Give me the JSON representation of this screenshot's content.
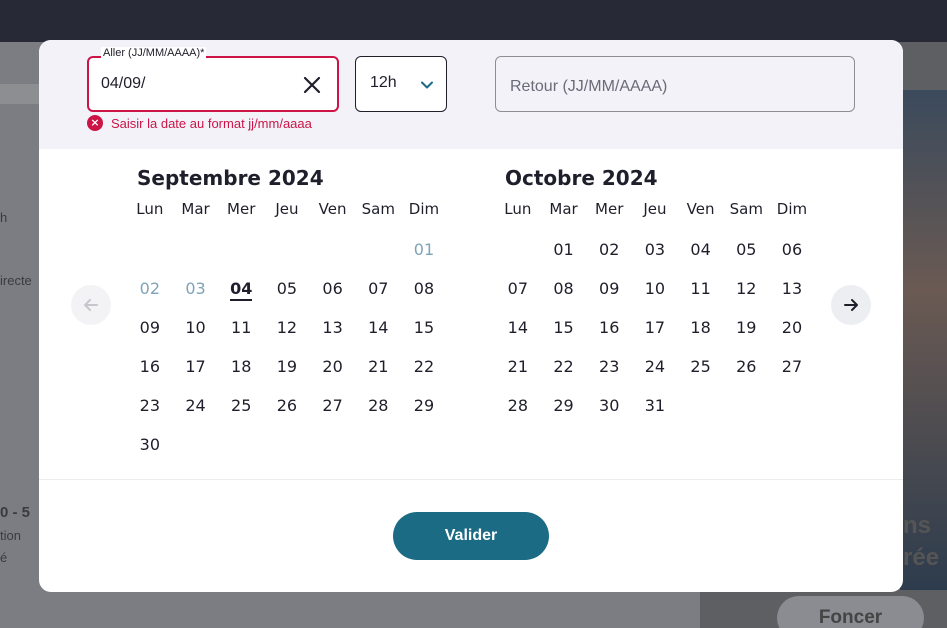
{
  "background": {
    "bg_text_1": "h",
    "bg_text_2": "irecte",
    "bg_text_3": "0 - 5",
    "bg_text_4": "tion",
    "bg_text_5": "é",
    "bg_text_6": "ns",
    "bg_text_7": "rée",
    "bg_button": "Foncer"
  },
  "form": {
    "aller": {
      "label": "Aller (JJ/MM/AAAA)*",
      "value": "04/09/",
      "error": "Saisir la date au format jj/mm/aaaa",
      "clear_icon": "close-icon"
    },
    "time": {
      "value": "12h",
      "icon": "chevron-down-icon"
    },
    "retour": {
      "placeholder": "Retour (JJ/MM/AAAA)"
    }
  },
  "weekdays": [
    "Lun",
    "Mar",
    "Mer",
    "Jeu",
    "Ven",
    "Sam",
    "Dim"
  ],
  "calendars": [
    {
      "title": "Septembre 2024",
      "offset": 6,
      "days": [
        "01",
        "02",
        "03",
        "04",
        "05",
        "06",
        "07",
        "08",
        "09",
        "10",
        "11",
        "12",
        "13",
        "14",
        "15",
        "16",
        "17",
        "18",
        "19",
        "20",
        "21",
        "22",
        "23",
        "24",
        "25",
        "26",
        "27",
        "28",
        "29",
        "30"
      ],
      "disabled": [
        "01",
        "02",
        "03"
      ],
      "selected": "04"
    },
    {
      "title": "Octobre 2024",
      "offset": 1,
      "days": [
        "01",
        "02",
        "03",
        "04",
        "05",
        "06",
        "07",
        "08",
        "09",
        "10",
        "11",
        "12",
        "13",
        "14",
        "15",
        "16",
        "17",
        "18",
        "19",
        "20",
        "21",
        "22",
        "23",
        "24",
        "25",
        "26",
        "27",
        "28",
        "29",
        "30",
        "31"
      ],
      "disabled": [],
      "selected": ""
    }
  ],
  "nav": {
    "prev_icon": "arrow-left-icon",
    "next_icon": "arrow-right-icon"
  },
  "actions": {
    "validate_label": "Valider"
  },
  "colors": {
    "error": "#cc1447",
    "primary": "#1c6b85",
    "disabled_day": "#7fa3b8"
  }
}
